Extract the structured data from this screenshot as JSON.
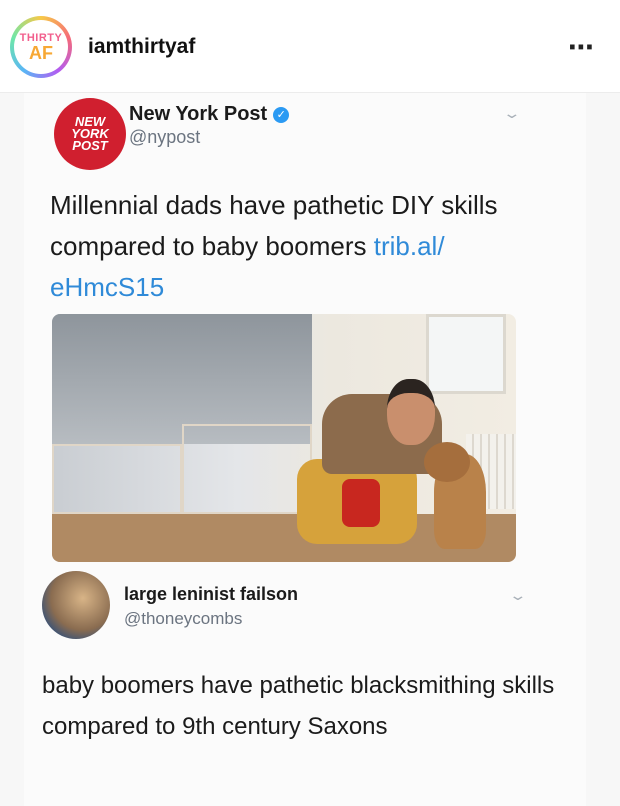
{
  "instagram": {
    "username": "iamthirtyaf",
    "avatar_text_top": "THIRTY",
    "avatar_text_bottom": "AF",
    "more_icon": "⋯"
  },
  "tweet1": {
    "logo_lines": [
      "NEW",
      "YORK",
      "POST"
    ],
    "display_name": "New York Post",
    "verified_icon": "✓",
    "handle": "@nypost",
    "text_before_link": "Millennial dads have pathetic DIY skills compared to baby boomers ",
    "link_text": "trib.al/\neHmcS15",
    "image_description_icon": "photo-man-drilling-with-dog"
  },
  "tweet2": {
    "display_name": "large leninist failson",
    "handle": "@thoneycombs",
    "text": "baby boomers have pathetic blacksmithing skills compared to 9th century Saxons"
  },
  "chevron_icon": "⌄",
  "colors": {
    "nypost_red": "#d01f2f",
    "link_blue": "#2f8ad8",
    "verified_blue": "#2b9af3",
    "handle_gray": "#6b7480"
  }
}
